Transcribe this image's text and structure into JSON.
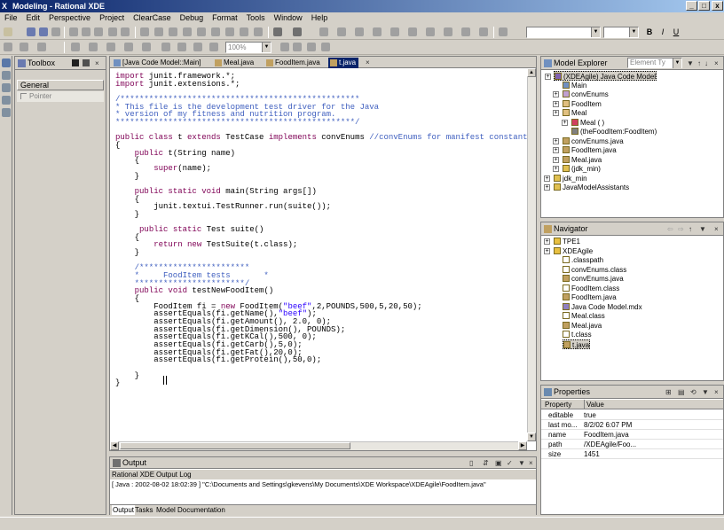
{
  "window": {
    "title": "Modeling - Rational XDE",
    "logo": "X",
    "minimize": "_",
    "maximize": "□",
    "close": "x"
  },
  "menu": [
    "File",
    "Edit",
    "Perspective",
    "Project",
    "ClearCase",
    "Debug",
    "Format",
    "Tools",
    "Window",
    "Help"
  ],
  "toolbar": {
    "zoom": "100%",
    "font_bold": "B",
    "font_italic": "I",
    "font_underline": "U"
  },
  "toolbox": {
    "title": "Toolbox",
    "section": "General",
    "item": "Pointer"
  },
  "editor": {
    "tabs": [
      "[Java Code Model::Main]",
      "Meal.java",
      "FoodItem.java",
      "t.java"
    ],
    "active_tab": "t.java"
  },
  "model_explorer": {
    "title": "Model Explorer",
    "filter": "Element Ty",
    "items": [
      {
        "label": "(XDEAgile) Java Code Model",
        "depth": 0,
        "icon": "model-icon"
      },
      {
        "label": "Main",
        "depth": 1,
        "icon": "diagram-icon"
      },
      {
        "label": "convEnums",
        "depth": 1,
        "icon": "interface-icon"
      },
      {
        "label": "FoodItem",
        "depth": 1,
        "icon": "class-icon"
      },
      {
        "label": "Meal",
        "depth": 1,
        "icon": "class-icon"
      },
      {
        "label": "Meal ( )",
        "depth": 2,
        "icon": "operation-icon"
      },
      {
        "label": "(theFoodItem:FoodItem)",
        "depth": 2,
        "icon": "association-icon"
      },
      {
        "label": "convEnums.java",
        "depth": 1,
        "icon": "java-file-icon"
      },
      {
        "label": "FoodItem.java",
        "depth": 1,
        "icon": "java-file-icon"
      },
      {
        "label": "Meal.java",
        "depth": 1,
        "icon": "java-file-icon"
      },
      {
        "label": "(jdk_min)",
        "depth": 1,
        "icon": "package-icon"
      },
      {
        "label": "jdk_min",
        "depth": 0,
        "icon": "package-icon"
      },
      {
        "label": "JavaModelAssistants",
        "depth": 0,
        "icon": "package-icon"
      }
    ]
  },
  "navigator": {
    "title": "Navigator",
    "items": [
      {
        "label": "TPE1",
        "depth": 0,
        "icon": "folder-icon"
      },
      {
        "label": "XDEAgile",
        "depth": 0,
        "icon": "folder-icon"
      },
      {
        "label": ".classpath",
        "depth": 1,
        "icon": "file-icon"
      },
      {
        "label": "convEnums.class",
        "depth": 1,
        "icon": "file-icon"
      },
      {
        "label": "convEnums.java",
        "depth": 1,
        "icon": "java-file-icon"
      },
      {
        "label": "FoodItem.class",
        "depth": 1,
        "icon": "file-icon"
      },
      {
        "label": "FoodItem.java",
        "depth": 1,
        "icon": "java-file-icon"
      },
      {
        "label": "Java Code Model.mdx",
        "depth": 1,
        "icon": "model-file-icon"
      },
      {
        "label": "Meal.class",
        "depth": 1,
        "icon": "file-icon"
      },
      {
        "label": "Meal.java",
        "depth": 1,
        "icon": "java-file-icon"
      },
      {
        "label": "t.class",
        "depth": 1,
        "icon": "file-icon"
      },
      {
        "label": "t.java",
        "depth": 1,
        "icon": "java-file-icon"
      }
    ]
  },
  "properties": {
    "title": "Properties",
    "col_property": "Property",
    "col_value": "Value",
    "rows": [
      {
        "k": "editable",
        "v": "true"
      },
      {
        "k": "last mo...",
        "v": "8/2/02 6:07 PM"
      },
      {
        "k": "name",
        "v": "FoodItem.java"
      },
      {
        "k": "path",
        "v": "/XDEAgile/Foo..."
      },
      {
        "k": "size",
        "v": "1451"
      }
    ]
  },
  "output": {
    "title": "Output",
    "tabs": [
      "Rational XDE",
      "Output Log"
    ],
    "line": "[ Java : 2002-08-02  18:02:39 ]   \"C:\\Documents and Settings\\gkevens\\My Documents\\XDE Workspace\\XDEAgile\\FoodItem.java\"",
    "bottom_tabs": [
      "Output",
      "Tasks",
      "Model Documentation"
    ]
  }
}
